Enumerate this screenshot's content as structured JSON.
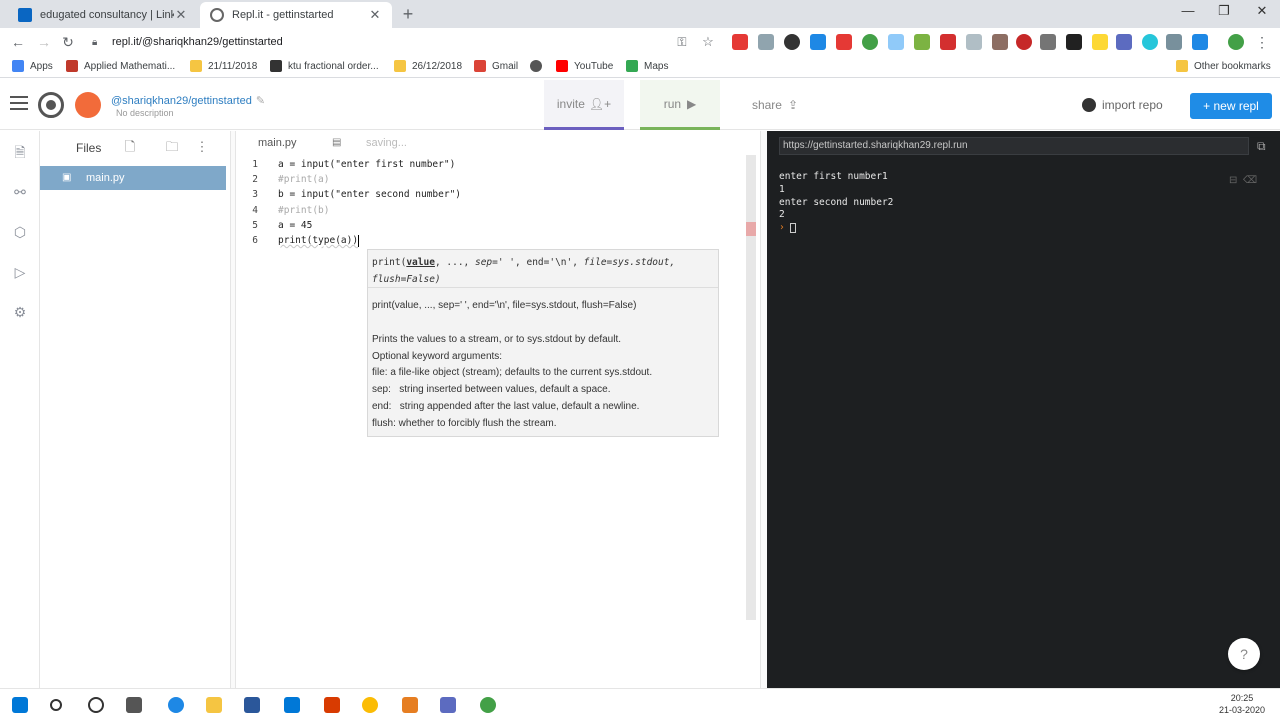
{
  "browser": {
    "tabs": [
      {
        "title": "edugated consultancy | LinkedIn",
        "favicon_color": "#0a66c2"
      },
      {
        "title": "Repl.it - gettinstarted",
        "favicon_color": "#666666"
      }
    ],
    "url": "repl.it/@shariqkhan29/gettinstarted",
    "bookmarks": [
      {
        "label": "Apps",
        "color": "#4285f4"
      },
      {
        "label": "Applied Mathemati...",
        "color": "#c0392b"
      },
      {
        "label": "21/11/2018",
        "color": "#f5c542"
      },
      {
        "label": "ktu fractional order...",
        "color": "#333333"
      },
      {
        "label": "26/12/2018",
        "color": "#f5c542"
      },
      {
        "label": "Gmail",
        "color": "#db4437"
      },
      {
        "label": "",
        "color": "#555555"
      },
      {
        "label": "YouTube",
        "color": "#ff0000"
      },
      {
        "label": "Maps",
        "color": "#34a853"
      },
      {
        "label": "Other bookmarks",
        "color": "#f5c542"
      }
    ]
  },
  "header": {
    "repl_name": "@shariqkhan29/gettinstarted",
    "description": "No description",
    "invite_label": "invite",
    "run_label": "run",
    "share_label": "share",
    "import_label": "import repo",
    "new_repl_label": "+ new repl"
  },
  "files": {
    "title": "Files",
    "items": [
      {
        "name": "main.py"
      }
    ]
  },
  "editor": {
    "tab": "main.py",
    "status": "saving...",
    "lines": [
      {
        "n": "1",
        "text": "a = input(\"enter first number\")"
      },
      {
        "n": "2",
        "text": "#print(a)"
      },
      {
        "n": "3",
        "text": "b = input(\"enter second number\")"
      },
      {
        "n": "4",
        "text": "#print(b)"
      },
      {
        "n": "5",
        "text": "a = 45"
      },
      {
        "n": "6",
        "text": "print(type(a))"
      }
    ]
  },
  "tooltip": {
    "signature_line1_pre": "print(",
    "signature_value": "value",
    "signature_line1_post": ", ..., ",
    "signature_sep": "sep=' '",
    "signature_end": ", end='\\n', ",
    "signature_file": "file=sys.stdout,",
    "signature_flush": "flush=False)",
    "doc_signature": "print(value, ..., sep=' ', end='\\n', file=sys.stdout, flush=False)",
    "doc_lines": [
      "Prints the values to a stream, or to sys.stdout by default.",
      "Optional keyword arguments:",
      "file:  a file-like object (stream); defaults to the current sys.stdout.",
      "sep:   string inserted between values, default a space.",
      "end:   string appended after the last value, default a newline.",
      "flush: whether to forcibly flush the stream."
    ]
  },
  "console": {
    "url": "https://gettinstarted.shariqkhan29.repl.run",
    "output": [
      "enter first number1",
      "1",
      "enter second number2",
      "2"
    ],
    "prompt_symbol": "›"
  },
  "taskbar": {
    "time": "20:25",
    "date": "21-03-2020"
  }
}
